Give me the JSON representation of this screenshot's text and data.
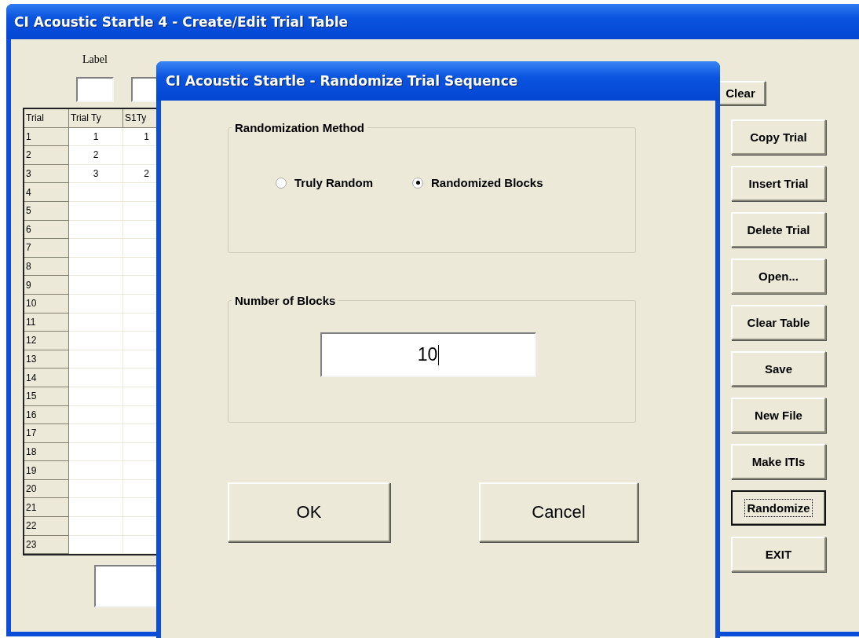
{
  "main_window": {
    "title": "CI Acoustic Startle 4 - Create/Edit Trial Table",
    "column_labels": [
      "Label"
    ],
    "clear_button": "Clear",
    "table": {
      "columns": [
        "Trial",
        "Trial Ty",
        "S1Ty"
      ],
      "rows": [
        {
          "trial": "1",
          "trial_type": "1",
          "s1_type": "1"
        },
        {
          "trial": "2",
          "trial_type": "2"
        },
        {
          "trial": "3",
          "trial_type": "3",
          "s1_type": "2"
        },
        {
          "trial": "4"
        },
        {
          "trial": "5"
        },
        {
          "trial": "6"
        },
        {
          "trial": "7"
        },
        {
          "trial": "8"
        },
        {
          "trial": "9"
        },
        {
          "trial": "10"
        },
        {
          "trial": "11"
        },
        {
          "trial": "12"
        },
        {
          "trial": "13"
        },
        {
          "trial": "14"
        },
        {
          "trial": "15"
        },
        {
          "trial": "16"
        },
        {
          "trial": "17"
        },
        {
          "trial": "18"
        },
        {
          "trial": "19"
        },
        {
          "trial": "20"
        },
        {
          "trial": "21"
        },
        {
          "trial": "22"
        },
        {
          "trial": "23"
        }
      ]
    },
    "buttons": [
      {
        "label": "Copy Trial",
        "focused": false
      },
      {
        "label": "Insert Trial",
        "focused": false
      },
      {
        "label": "Delete Trial",
        "focused": false
      },
      {
        "label": "Open...",
        "focused": false
      },
      {
        "label": "Clear Table",
        "focused": false
      },
      {
        "label": "Save",
        "focused": false
      },
      {
        "label": "New File",
        "focused": false
      },
      {
        "label": "Make ITIs",
        "focused": false
      },
      {
        "label": "Randomize",
        "focused": true
      },
      {
        "label": "EXIT",
        "focused": false
      }
    ]
  },
  "dialog": {
    "title": "CI Acoustic Startle - Randomize Trial Sequence",
    "method_group": {
      "title": "Randomization Method",
      "options": [
        {
          "label": "Truly Random",
          "selected": false
        },
        {
          "label": "Randomized Blocks",
          "selected": true
        }
      ]
    },
    "blocks_group": {
      "title": "Number of Blocks",
      "value": "10"
    },
    "buttons": [
      "OK",
      "Cancel"
    ]
  }
}
